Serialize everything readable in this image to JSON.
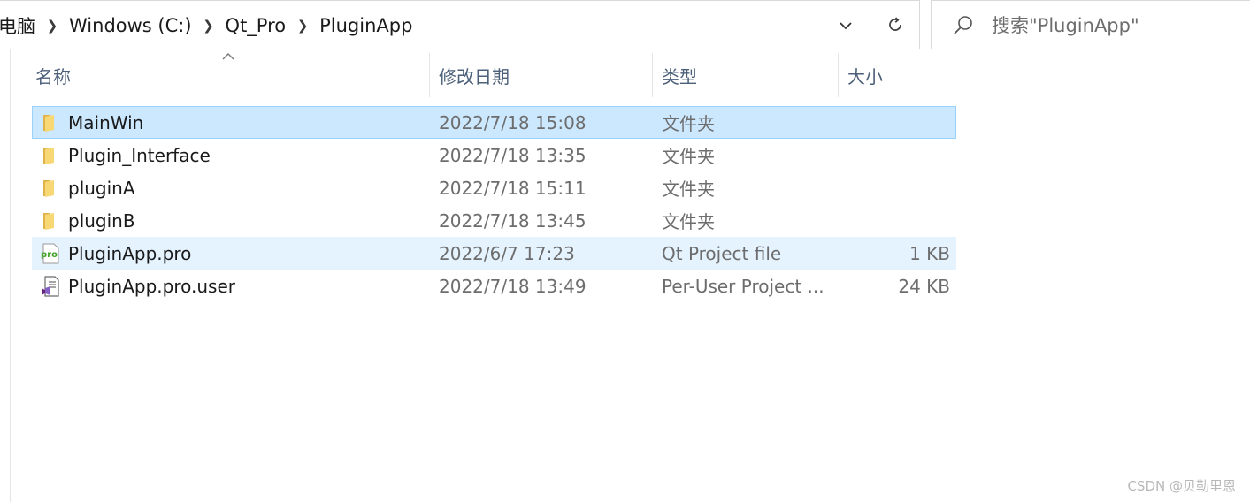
{
  "address_bar": {
    "crumbs": [
      {
        "label": "电脑"
      },
      {
        "label": "Windows (C:)"
      },
      {
        "label": "Qt_Pro"
      },
      {
        "label": "PluginApp"
      }
    ],
    "separator_icon": "chevron-right-icon",
    "history_icon": "chevron-down-icon",
    "refresh_icon": "refresh-icon"
  },
  "search": {
    "placeholder": "搜索\"PluginApp\"",
    "icon": "search-icon"
  },
  "columns": {
    "name": "名称",
    "date": "修改日期",
    "type": "类型",
    "size": "大小",
    "sort_icon": "sort-up-icon"
  },
  "files": [
    {
      "name": "MainWin",
      "date": "2022/7/18 15:08",
      "type": "文件夹",
      "size": "",
      "icon": "folder-icon",
      "state": "selected"
    },
    {
      "name": "Plugin_Interface",
      "date": "2022/7/18 13:35",
      "type": "文件夹",
      "size": "",
      "icon": "folder-icon",
      "state": ""
    },
    {
      "name": "pluginA",
      "date": "2022/7/18 15:11",
      "type": "文件夹",
      "size": "",
      "icon": "folder-icon",
      "state": ""
    },
    {
      "name": "pluginB",
      "date": "2022/7/18 13:45",
      "type": "文件夹",
      "size": "",
      "icon": "folder-icon",
      "state": ""
    },
    {
      "name": "PluginApp.pro",
      "date": "2022/6/7 17:23",
      "type": "Qt Project file",
      "size": "1 KB",
      "icon": "qt-pro-file-icon",
      "state": "hover"
    },
    {
      "name": "PluginApp.pro.user",
      "date": "2022/7/18 13:49",
      "type": "Per-User Project ...",
      "size": "24 KB",
      "icon": "user-project-file-icon",
      "state": ""
    }
  ],
  "colors": {
    "selected_bg": "#cce8ff",
    "selected_border": "#99d1ff",
    "hover_bg": "#e5f3ff",
    "header_text": "#4c607a",
    "folder": "#f8d775"
  },
  "watermark": "CSDN @贝勒里恩"
}
